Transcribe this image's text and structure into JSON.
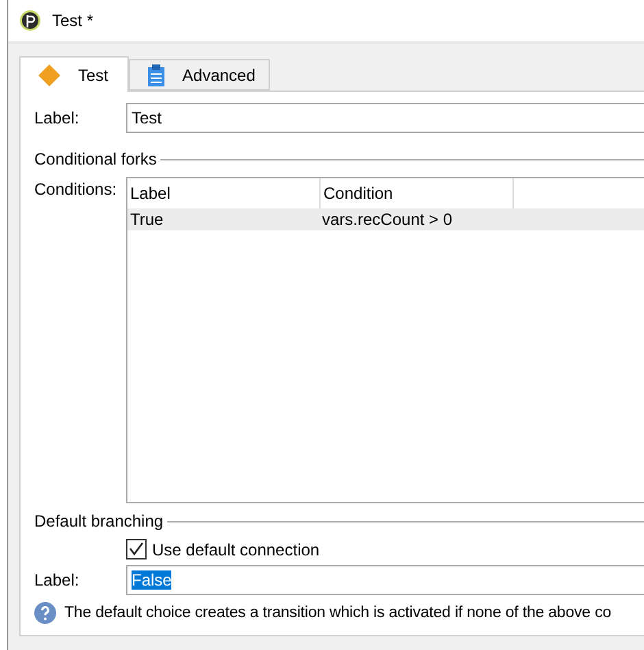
{
  "window": {
    "title": "Test *"
  },
  "tabs": [
    {
      "label": "Test",
      "selected": true
    },
    {
      "label": "Advanced",
      "selected": false
    }
  ],
  "label_field": {
    "label": "Label:",
    "value": "Test"
  },
  "conditional_forks": {
    "title": "Conditional forks",
    "conditions_label": "Conditions:",
    "columns": [
      "Label",
      "Condition"
    ],
    "rows": [
      {
        "cells": [
          "True",
          "vars.recCount > 0"
        ],
        "selected": true
      }
    ]
  },
  "default_branching": {
    "title": "Default branching",
    "use_default": {
      "label": "Use default connection",
      "checked": true
    },
    "label": "Label:",
    "value": "False",
    "info": "The default choice creates a transition which is activated if none of the above co"
  }
}
